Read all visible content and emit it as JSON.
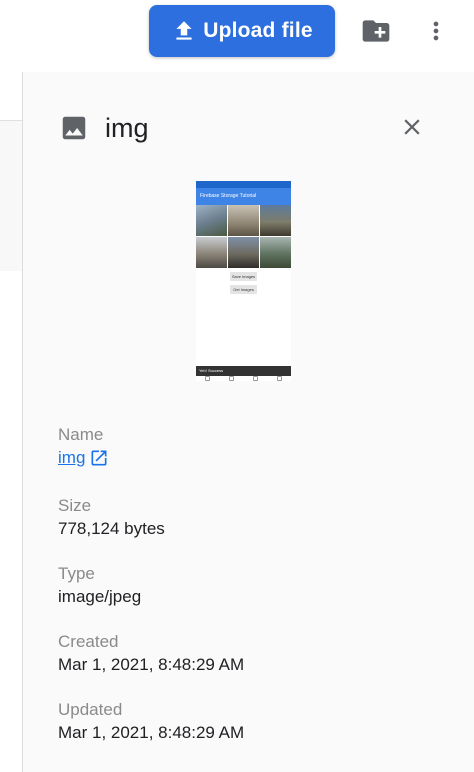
{
  "toolbar": {
    "upload_label": "Upload file",
    "upload_color": "#2d6fdf"
  },
  "icons": {
    "upload": "upload-arrow-icon",
    "new_folder": "folder-plus-icon",
    "more": "more-vert-icon",
    "file_type": "image-icon",
    "close": "close-icon",
    "external": "open-in-new-icon"
  },
  "panel": {
    "title": "img",
    "preview": {
      "app_title": "Firebase Storage Tutorial",
      "button_save": "Save Images",
      "button_get": "Get Images",
      "toast": "Yeh! Success"
    },
    "fields": [
      {
        "label": "Name",
        "value": "img"
      },
      {
        "label": "Size",
        "value": "778,124 bytes"
      },
      {
        "label": "Type",
        "value": "image/jpeg"
      },
      {
        "label": "Created",
        "value": "Mar 1, 2021, 8:48:29 AM"
      },
      {
        "label": "Updated",
        "value": "Mar 1, 2021, 8:48:29 AM"
      }
    ]
  }
}
